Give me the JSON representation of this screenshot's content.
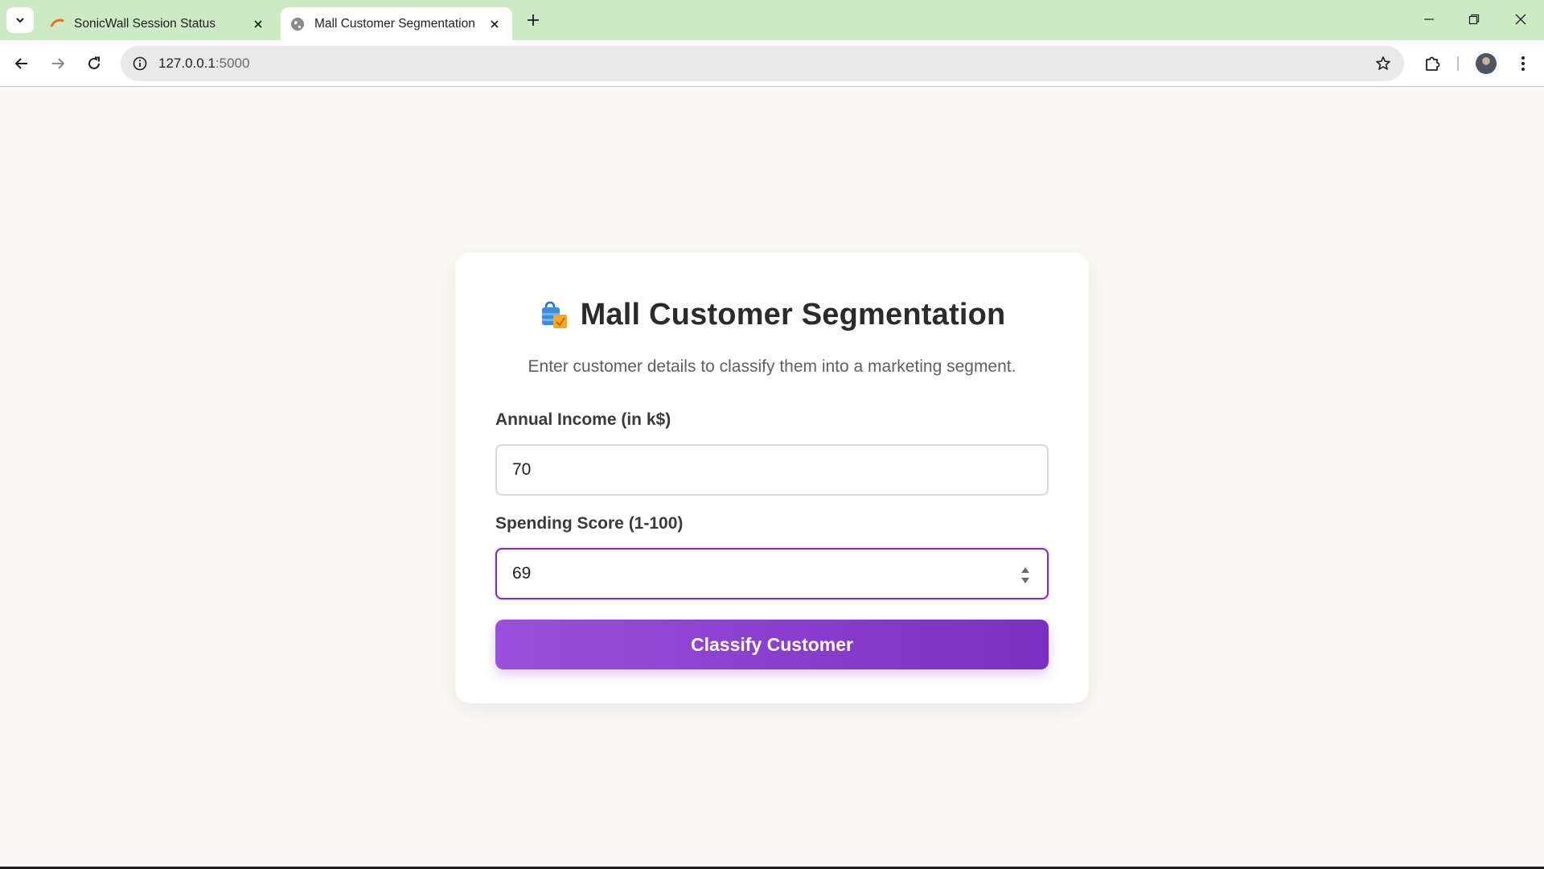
{
  "browser": {
    "tabs": [
      {
        "title": "SonicWall Session Status",
        "favicon": "sonicwall-logo-icon",
        "active": false
      },
      {
        "title": "Mall Customer Segmentation",
        "favicon": "globe-icon",
        "active": true
      }
    ],
    "address": {
      "host": "127.0.0.1",
      "port": ":5000"
    }
  },
  "page": {
    "title": "Mall Customer Segmentation",
    "title_icon": "shopping-bags-icon",
    "subtitle": "Enter customer details to classify them into a marketing segment.",
    "fields": {
      "income": {
        "label": "Annual Income (in k$)",
        "value": "70"
      },
      "score": {
        "label": "Spending Score (1-100)",
        "value": "69",
        "focused": true
      }
    },
    "submit_label": "Classify Customer"
  },
  "colors": {
    "tabstrip_bg": "#cceac3",
    "page_bg": "#fcf9f5",
    "accent": "#7a2fc1",
    "button_gradient_start": "#9b4fdc"
  }
}
